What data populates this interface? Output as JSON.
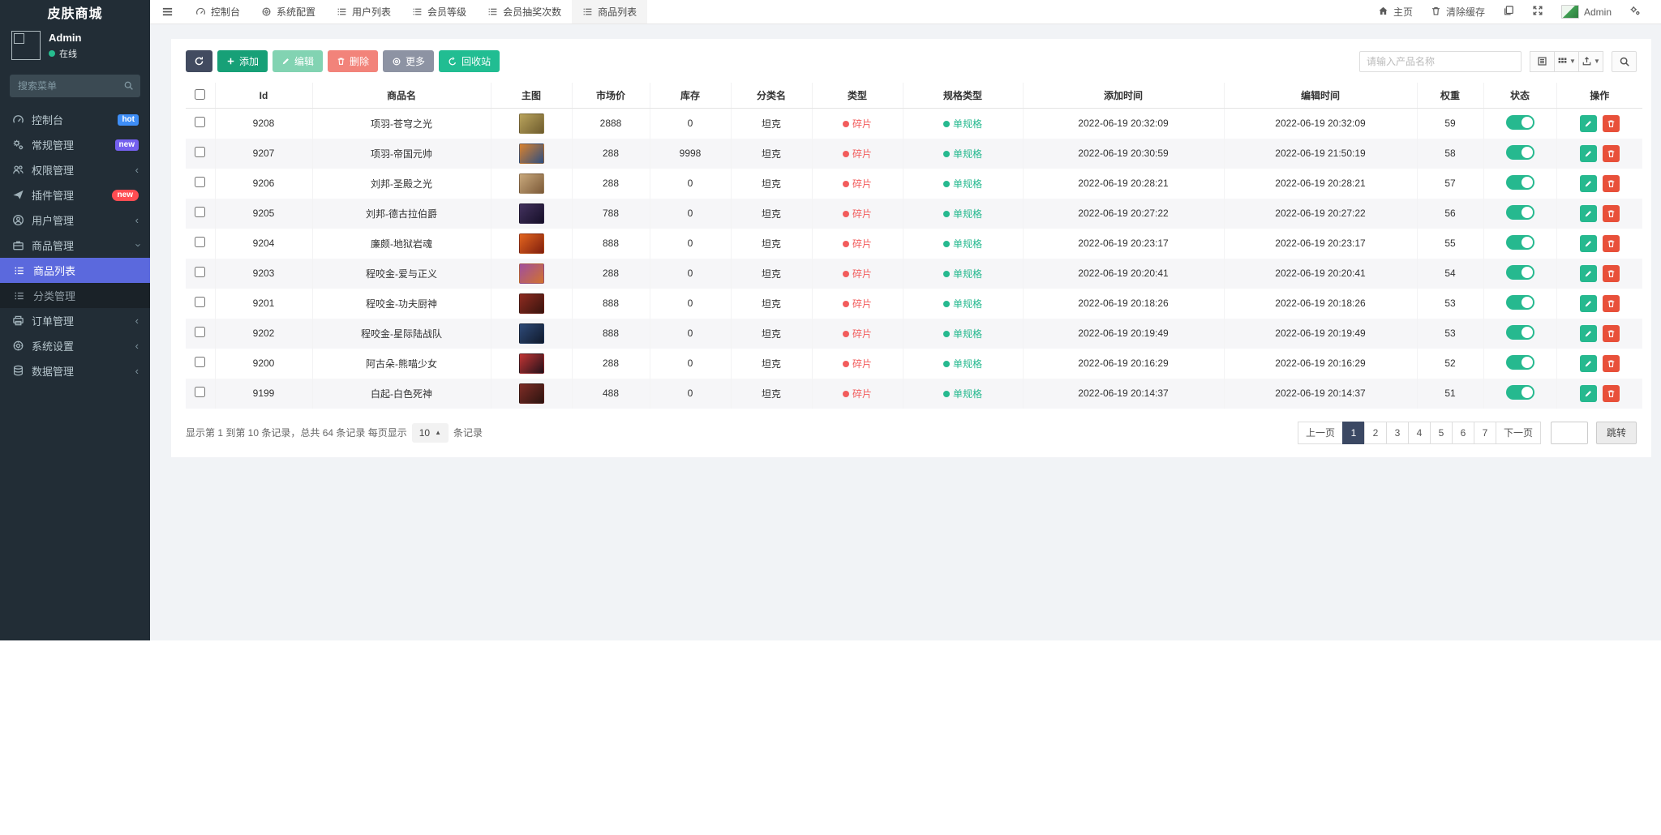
{
  "brand": "皮肤商城",
  "user": {
    "name": "Admin",
    "status": "在线"
  },
  "sidebar": {
    "search_placeholder": "搜索菜单",
    "items": [
      {
        "label": "控制台",
        "badge": "hot"
      },
      {
        "label": "常规管理",
        "badge": "new"
      },
      {
        "label": "权限管理"
      },
      {
        "label": "插件管理",
        "badge": "new"
      },
      {
        "label": "用户管理"
      },
      {
        "label": "商品管理"
      }
    ],
    "submenu": [
      {
        "label": "商品列表",
        "active": true
      },
      {
        "label": "分类管理",
        "active": false
      }
    ],
    "bottom_items": [
      {
        "label": "订单管理"
      },
      {
        "label": "系统设置"
      },
      {
        "label": "数据管理"
      }
    ]
  },
  "navbar": {
    "tabs": [
      {
        "label": "控制台"
      },
      {
        "label": "系统配置"
      },
      {
        "label": "用户列表"
      },
      {
        "label": "会员等级"
      },
      {
        "label": "会员抽奖次数"
      },
      {
        "label": "商品列表"
      }
    ],
    "active_tab": "商品列表",
    "home": "主页",
    "clear_cache": "清除缓存",
    "username": "Admin"
  },
  "toolbar": {
    "add": "添加",
    "edit": "编辑",
    "delete": "删除",
    "more": "更多",
    "recycle": "回收站",
    "search_placeholder": "请输入产品名称"
  },
  "table": {
    "columns": [
      "Id",
      "商品名",
      "主图",
      "市场价",
      "库存",
      "分类名",
      "类型",
      "规格类型",
      "添加时间",
      "编辑时间",
      "权重",
      "状态",
      "操作"
    ],
    "rows": [
      {
        "id": "9208",
        "name": "项羽-苍穹之光",
        "price": "2888",
        "stock": "0",
        "category": "坦克",
        "type": "碎片",
        "spec": "单规格",
        "added": "2022-06-19 20:32:09",
        "edited": "2022-06-19 20:32:09",
        "weight": "59",
        "thumb": [
          "#b9a35c",
          "#6e5c2e"
        ]
      },
      {
        "id": "9207",
        "name": "项羽-帝国元帅",
        "price": "288",
        "stock": "9998",
        "category": "坦克",
        "type": "碎片",
        "spec": "单规格",
        "added": "2022-06-19 20:30:59",
        "edited": "2022-06-19 21:50:19",
        "weight": "58",
        "thumb": [
          "#d9822e",
          "#2e4e80"
        ]
      },
      {
        "id": "9206",
        "name": "刘邦-圣殿之光",
        "price": "288",
        "stock": "0",
        "category": "坦克",
        "type": "碎片",
        "spec": "单规格",
        "added": "2022-06-19 20:28:21",
        "edited": "2022-06-19 20:28:21",
        "weight": "57",
        "thumb": [
          "#c8a87c",
          "#7c5a38"
        ]
      },
      {
        "id": "9205",
        "name": "刘邦-德古拉伯爵",
        "price": "788",
        "stock": "0",
        "category": "坦克",
        "type": "碎片",
        "spec": "单规格",
        "added": "2022-06-19 20:27:22",
        "edited": "2022-06-19 20:27:22",
        "weight": "56",
        "thumb": [
          "#43325e",
          "#160f28"
        ]
      },
      {
        "id": "9204",
        "name": "廉颇-地狱岩魂",
        "price": "888",
        "stock": "0",
        "category": "坦克",
        "type": "碎片",
        "spec": "单规格",
        "added": "2022-06-19 20:23:17",
        "edited": "2022-06-19 20:23:17",
        "weight": "55",
        "thumb": [
          "#e2641e",
          "#801f0e"
        ]
      },
      {
        "id": "9203",
        "name": "程咬金-爱与正义",
        "price": "288",
        "stock": "0",
        "category": "坦克",
        "type": "碎片",
        "spec": "单规格",
        "added": "2022-06-19 20:20:41",
        "edited": "2022-06-19 20:20:41",
        "weight": "54",
        "thumb": [
          "#a04f9e",
          "#d1722e"
        ]
      },
      {
        "id": "9201",
        "name": "程咬金-功夫厨神",
        "price": "888",
        "stock": "0",
        "category": "坦克",
        "type": "碎片",
        "spec": "单规格",
        "added": "2022-06-19 20:18:26",
        "edited": "2022-06-19 20:18:26",
        "weight": "53",
        "thumb": [
          "#8e2b20",
          "#39140e"
        ]
      },
      {
        "id": "9202",
        "name": "程咬金-星际陆战队",
        "price": "888",
        "stock": "0",
        "category": "坦克",
        "type": "碎片",
        "spec": "单规格",
        "added": "2022-06-19 20:19:49",
        "edited": "2022-06-19 20:19:49",
        "weight": "53",
        "thumb": [
          "#2e4a78",
          "#101a2c"
        ]
      },
      {
        "id": "9200",
        "name": "阿古朵-熊喵少女",
        "price": "288",
        "stock": "0",
        "category": "坦克",
        "type": "碎片",
        "spec": "单规格",
        "added": "2022-06-19 20:16:29",
        "edited": "2022-06-19 20:16:29",
        "weight": "52",
        "thumb": [
          "#c23434",
          "#23121a"
        ]
      },
      {
        "id": "9199",
        "name": "白起-白色死神",
        "price": "488",
        "stock": "0",
        "category": "坦克",
        "type": "碎片",
        "spec": "单规格",
        "added": "2022-06-19 20:14:37",
        "edited": "2022-06-19 20:14:37",
        "weight": "51",
        "thumb": [
          "#7e2c26",
          "#2c1410"
        ]
      }
    ]
  },
  "footer": {
    "summary_prefix": "显示第 1 到第 10 条记录，总共 64 条记录 每页显示",
    "page_size": "10",
    "summary_suffix": "条记录",
    "pagination": {
      "prev": "上一页",
      "pages": [
        "1",
        "2",
        "3",
        "4",
        "5",
        "6",
        "7"
      ],
      "active": "1",
      "next": "下一页",
      "jump_label": "跳转"
    }
  },
  "colors": {
    "accent_green": "#26b98f",
    "accent_red": "#f25c5c",
    "active_menu": "#5b69dd",
    "page_active": "#3b4863"
  }
}
